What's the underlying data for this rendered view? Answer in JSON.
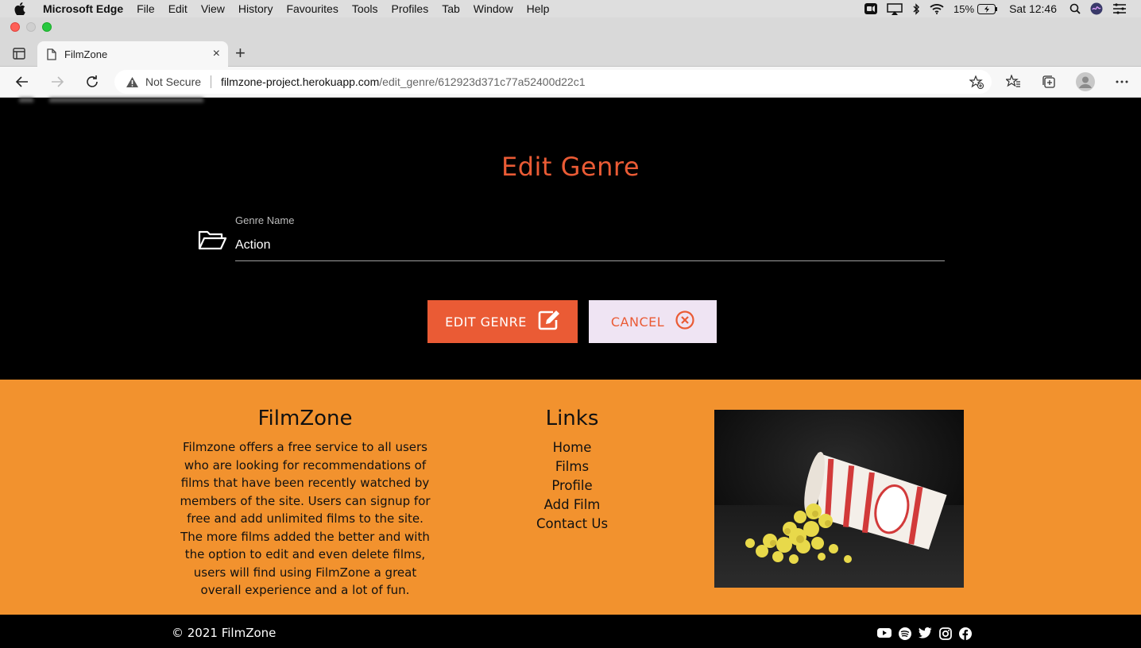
{
  "menubar": {
    "app": "Microsoft Edge",
    "items": [
      "File",
      "Edit",
      "View",
      "History",
      "Favourites",
      "Tools",
      "Profiles",
      "Tab",
      "Window",
      "Help"
    ],
    "battery": "15%",
    "clock": "Sat 12:46"
  },
  "tab": {
    "title": "FilmZone",
    "close": "×",
    "new": "+"
  },
  "address": {
    "security": "Not Secure",
    "host": "filmzone-project.herokuapp.com",
    "path": "/edit_genre/612923d371c77a52400d22c1"
  },
  "form": {
    "title": "Edit Genre",
    "label": "Genre Name",
    "value": "Action",
    "edit_button": "EDIT GENRE",
    "cancel_button": "CANCEL"
  },
  "footer": {
    "about_title": "FilmZone",
    "about_text": "Filmzone offers a free service to all users who are looking for recommendations of films that have been recently watched by members of the site. Users can signup for free and add unlimited films to the site. The more films added the better and with the option to edit and even delete films, users will find using FilmZone a great overall experience and a lot of fun.",
    "links_title": "Links",
    "links": [
      "Home",
      "Films",
      "Profile",
      "Add Film",
      "Contact Us"
    ],
    "copyright": "© 2021 FilmZone",
    "social_icons": [
      "youtube-icon",
      "spotify-icon",
      "twitter-icon",
      "instagram-icon",
      "facebook-icon"
    ]
  },
  "colors": {
    "accent": "#ea5b35",
    "footer_bg": "#f2922e",
    "cancel_bg": "#efe4f3"
  }
}
